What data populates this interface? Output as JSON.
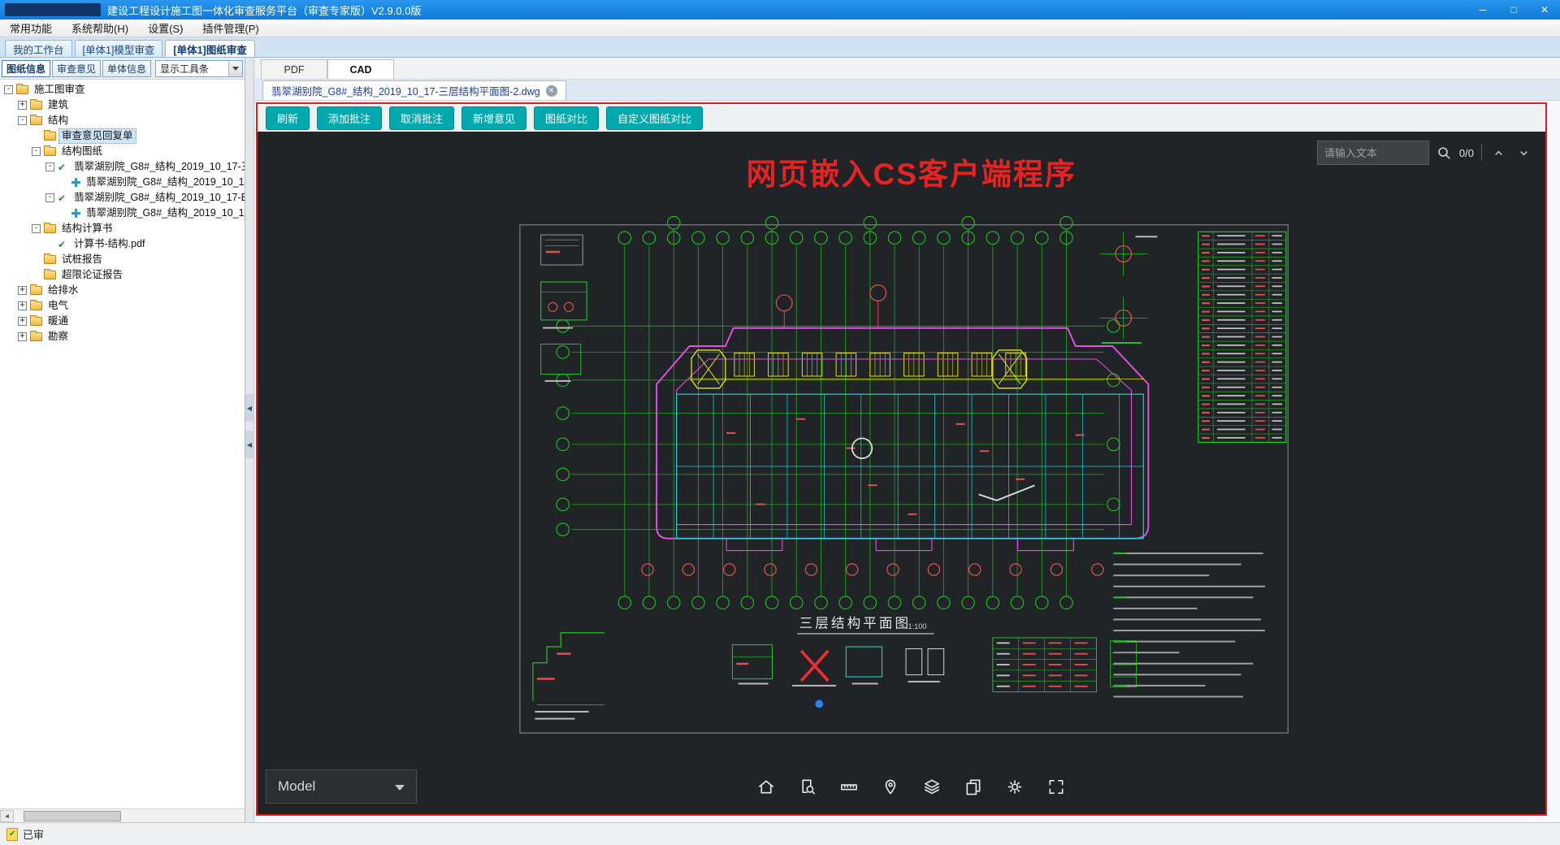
{
  "window": {
    "title": "建设工程设计施工图一体化审查服务平台（审查专家版）V2.9.0.0版",
    "controls": {
      "minimize": "─",
      "maximize": "□",
      "close": "✕"
    }
  },
  "menu": {
    "items": [
      "常用功能",
      "系统帮助(H)",
      "设置(S)",
      "插件管理(P)"
    ]
  },
  "workspace_tabs": {
    "items": [
      {
        "label": "我的工作台",
        "active": false
      },
      {
        "label": "[单体1]模型审查",
        "active": false
      },
      {
        "label": "[单体1]图纸审查",
        "active": true
      }
    ]
  },
  "left_panel": {
    "tabs": [
      {
        "label": "图纸信息",
        "active": true
      },
      {
        "label": "审查意见",
        "active": false
      },
      {
        "label": "单体信息",
        "active": false
      }
    ],
    "toolbar_select": "显示工具条",
    "tree": [
      {
        "depth": 0,
        "expander": "minus",
        "icon": "folder",
        "label": "施工图审查"
      },
      {
        "depth": 1,
        "expander": "plus",
        "icon": "folder",
        "label": "建筑"
      },
      {
        "depth": 1,
        "expander": "minus",
        "icon": "folder",
        "label": "结构"
      },
      {
        "depth": 2,
        "expander": "none",
        "icon": "folder",
        "label": "审查意见回复单",
        "selected": true
      },
      {
        "depth": 2,
        "expander": "minus",
        "icon": "folder",
        "label": "结构图纸"
      },
      {
        "depth": 3,
        "expander": "minus",
        "icon": "check",
        "label": "翡翠湖别院_G8#_结构_2019_10_17-三"
      },
      {
        "depth": 4,
        "expander": "none",
        "icon": "plus",
        "label": "翡翠湖别院_G8#_结构_2019_10_1"
      },
      {
        "depth": 3,
        "expander": "minus",
        "icon": "check",
        "label": "翡翠湖别院_G8#_结构_2019_10_17-E"
      },
      {
        "depth": 4,
        "expander": "none",
        "icon": "plus",
        "label": "翡翠湖别院_G8#_结构_2019_10_1"
      },
      {
        "depth": 2,
        "expander": "minus",
        "icon": "folder",
        "label": "结构计算书"
      },
      {
        "depth": 3,
        "expander": "none",
        "icon": "check",
        "label": "计算书-结构.pdf"
      },
      {
        "depth": 2,
        "expander": "none",
        "icon": "folder",
        "label": "试桩报告"
      },
      {
        "depth": 2,
        "expander": "none",
        "icon": "folder",
        "label": "超限论证报告"
      },
      {
        "depth": 1,
        "expander": "plus",
        "icon": "folder",
        "label": "给排水"
      },
      {
        "depth": 1,
        "expander": "plus",
        "icon": "folder",
        "label": "电气"
      },
      {
        "depth": 1,
        "expander": "plus",
        "icon": "folder",
        "label": "暖通"
      },
      {
        "depth": 1,
        "expander": "plus",
        "icon": "folder",
        "label": "勘察"
      }
    ]
  },
  "viewer": {
    "format_tabs": [
      {
        "label": "PDF",
        "active": false
      },
      {
        "label": "CAD",
        "active": true
      }
    ],
    "document_tab": {
      "title": "翡翠湖别院_G8#_结构_2019_10_17-三层结构平面图-2.dwg"
    },
    "toolbar": [
      "刷新",
      "添加批注",
      "取消批注",
      "新增意见",
      "图纸对比",
      "自定义图纸对比"
    ],
    "overlay_text": "网页嵌入CS客户端程序",
    "search": {
      "placeholder": "请输入文本",
      "counter": "0/0"
    },
    "drawing": {
      "title": "三层结构平面图",
      "scale": "1:100"
    },
    "model_selector": {
      "label": "Model"
    }
  },
  "status_bar": {
    "label": "已审"
  },
  "colors": {
    "titlebar_blue": "#1585e2",
    "accent_teal": "#00a9ae",
    "frame_red": "#e21d1d",
    "overlay_red": "#e62222",
    "cad_green": "#1ec41e",
    "cad_magenta": "#e24fe2",
    "cad_cyan": "#17d1d1",
    "cad_yellow": "#e2e216",
    "cad_red": "#e05252",
    "canvas_bg": "#212427"
  }
}
